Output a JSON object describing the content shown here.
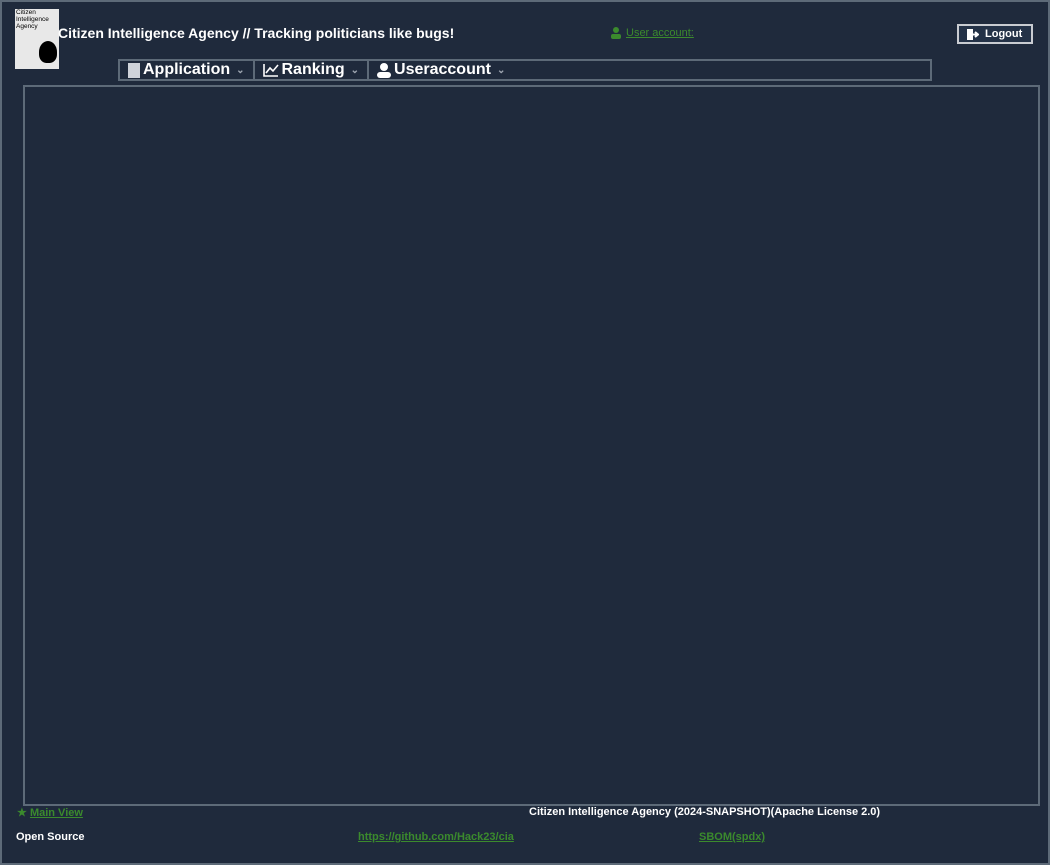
{
  "header": {
    "logo_lines": [
      "Citizen",
      "Intelligence",
      "Agency"
    ],
    "title": "Citizen Intelligence Agency  // Tracking politicians like bugs!",
    "user_account_label": "User account:",
    "logout_label": "Logout"
  },
  "menu": {
    "items": [
      {
        "label": "Application"
      },
      {
        "label": "Ranking"
      },
      {
        "label": "Useraccount"
      }
    ]
  },
  "footer": {
    "main_view": "Main View",
    "version": "Citizen Intelligence Agency (2024-SNAPSHOT)(Apache License 2.0)",
    "open_source": "Open Source",
    "github": "https://github.com/Hack23/cia",
    "sbom": "SBOM(spdx)"
  },
  "colors": {
    "background": "#1f2a3c",
    "link": "#3b8a2d",
    "border": "#5d6a78"
  }
}
